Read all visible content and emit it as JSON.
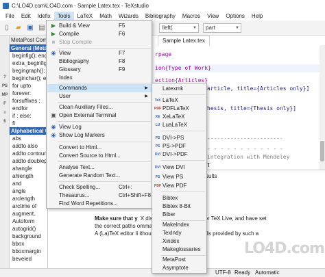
{
  "window": {
    "title": "C:\\LO4D.com\\LO4D.com - Sample Latex.tex - TeXstudio"
  },
  "menubar": [
    {
      "label": "File"
    },
    {
      "label": "Edit"
    },
    {
      "label": "Idefix"
    },
    {
      "label": "Tools"
    },
    {
      "label": "LaTeX"
    },
    {
      "label": "Math"
    },
    {
      "label": "Wizards"
    },
    {
      "label": "Bibliography"
    },
    {
      "label": "Macros"
    },
    {
      "label": "View"
    },
    {
      "label": "Options"
    },
    {
      "label": "Help"
    }
  ],
  "toolbar": {
    "left_font_combo": "\\left(",
    "part_combo": "part"
  },
  "left_strip_icons": [
    "?",
    "PS",
    "MP",
    "F",
    "≡",
    "fi"
  ],
  "side_panel": {
    "header": "MetaPost Commands",
    "general_section": "General (MetaP",
    "general_items": [
      "beginfig(); endfi",
      "extra_beginfig();",
      "begingraph(); en",
      "beginchar(); en",
      "for upto",
      "forever:",
      "forsuffixes :",
      "endfor",
      "if : else:",
      "fi"
    ],
    "alpha_section": "Alphabetical Co",
    "alpha_items": [
      "abs",
      "addto also",
      "addto contour",
      "addto doublepat",
      "ahangle",
      "ahlength",
      "and",
      "angle",
      "arclength",
      "arctime of",
      "augment.",
      "Autoform",
      "autogrid()",
      "background",
      "bbox",
      "bboxmargin",
      "beveled"
    ]
  },
  "editor": {
    "tab_label": "Sample Latex.tex",
    "lines": [
      {
        "text": "rpage",
        "kind": "kw"
      },
      {
        "text": "ion{Type of Work}",
        "kind": "hl"
      },
      {
        "text": "ection{Articles}",
        "kind": "kw"
      },
      {
        "text": "article, title={Articles only}]",
        "kind": "arg"
      },
      {
        "text": "hesis, title={Thesis only}]",
        "kind": "arg"
      },
      {
        "text": "-----------------------",
        "kind": "cm"
      },
      {
        "text": "- - - - - - - - - - - -",
        "kind": "cm"
      },
      {
        "text": " integration with Mendeley",
        "kind": "cm"
      },
      {
        "text": "T",
        "kind": "plain"
      }
    ]
  },
  "bottom_panel": {
    "header": "sults",
    "messages": [
      {
        "bold": "Make sure that y",
        "text": "X distribution e.g. MiKTeX or TeX Live, and have set"
      },
      {
        "bold": "",
        "text": "the correct paths        ommand configuration page."
      },
      {
        "bold": "",
        "text": "A (La)TeX editor li      ithout the (La)TeX commands provided by such a"
      }
    ]
  },
  "tools_menu": {
    "items": [
      {
        "icon": "▶",
        "label": "Build & View",
        "shortcut": "F5",
        "state": "normal"
      },
      {
        "icon": "▶",
        "label": "Compile",
        "shortcut": "F6",
        "state": "normal"
      },
      {
        "icon": "■",
        "label": "Stop Compile",
        "shortcut": "",
        "state": "disabled"
      },
      {
        "icon": "◉",
        "label": "View",
        "shortcut": "F7",
        "state": "normal"
      },
      {
        "icon": "",
        "label": "Bibliography",
        "shortcut": "F8",
        "state": "normal"
      },
      {
        "icon": "",
        "label": "Glossary",
        "shortcut": "F9",
        "state": "normal"
      },
      {
        "icon": "",
        "label": "Index",
        "shortcut": "",
        "state": "normal"
      },
      {
        "icon": "",
        "label": "Commands",
        "shortcut": "",
        "state": "highlighted",
        "submenu": true
      },
      {
        "icon": "",
        "label": "User",
        "shortcut": "",
        "state": "normal",
        "submenu": true
      },
      {
        "icon": "",
        "label": "Clean Auxiliary Files...",
        "shortcut": "",
        "state": "normal"
      },
      {
        "icon": "▣",
        "label": "Open External Terminal",
        "shortcut": "",
        "state": "normal"
      },
      {
        "icon": "◉",
        "label": "View Log",
        "shortcut": "",
        "state": "normal"
      },
      {
        "icon": "◉",
        "label": "Show Log Markers",
        "shortcut": "",
        "state": "normal"
      },
      {
        "icon": "",
        "label": "Convert to Html...",
        "shortcut": "",
        "state": "normal"
      },
      {
        "icon": "",
        "label": "Convert Source to Html...",
        "shortcut": "",
        "state": "normal"
      },
      {
        "icon": "",
        "label": "Analyse Text...",
        "shortcut": "",
        "state": "normal"
      },
      {
        "icon": "",
        "label": "Generate Random Text...",
        "shortcut": "",
        "state": "normal"
      },
      {
        "icon": "",
        "label": "Check Spelling...",
        "shortcut": "Ctrl+:",
        "state": "normal"
      },
      {
        "icon": "",
        "label": "Thesaurus...",
        "shortcut": "Ctrl+Shift+F8",
        "state": "normal"
      },
      {
        "icon": "",
        "label": "Find Word Repetitions...",
        "shortcut": "",
        "state": "normal"
      }
    ]
  },
  "commands_submenu": {
    "items": [
      {
        "icon": "",
        "label": "Latexmk"
      },
      {
        "icon": "TeX",
        "label": "LaTeX"
      },
      {
        "icon": "PDF",
        "label": "PDFLaTeX"
      },
      {
        "icon": "XE",
        "label": "XeLaTeX"
      },
      {
        "icon": "LU",
        "label": "LuaLaTeX"
      },
      {
        "icon": "PS",
        "label": "DVI->PS"
      },
      {
        "icon": "PS",
        "label": "PS->PDF"
      },
      {
        "icon": "DVI",
        "label": "DVI->PDF"
      },
      {
        "icon": "DVI",
        "label": "View DVI"
      },
      {
        "icon": "PS",
        "label": "View PS"
      },
      {
        "icon": "PDF",
        "label": "View PDF"
      },
      {
        "icon": "",
        "label": "Bibtex"
      },
      {
        "icon": "",
        "label": "Bibtex 8-Bit"
      },
      {
        "icon": "",
        "label": "Biber"
      },
      {
        "icon": "",
        "label": "MakeIndex"
      },
      {
        "icon": "",
        "label": "TexIndy"
      },
      {
        "icon": "",
        "label": "Xindex"
      },
      {
        "icon": "",
        "label": "Makeglossaries"
      },
      {
        "icon": "",
        "label": "MetaPost"
      },
      {
        "icon": "",
        "label": "Asymptote"
      }
    ]
  },
  "statusbar": {
    "encoding": "UTF-8",
    "state": "Ready",
    "mode": "Automatic"
  },
  "watermark": "LO4D.com"
}
